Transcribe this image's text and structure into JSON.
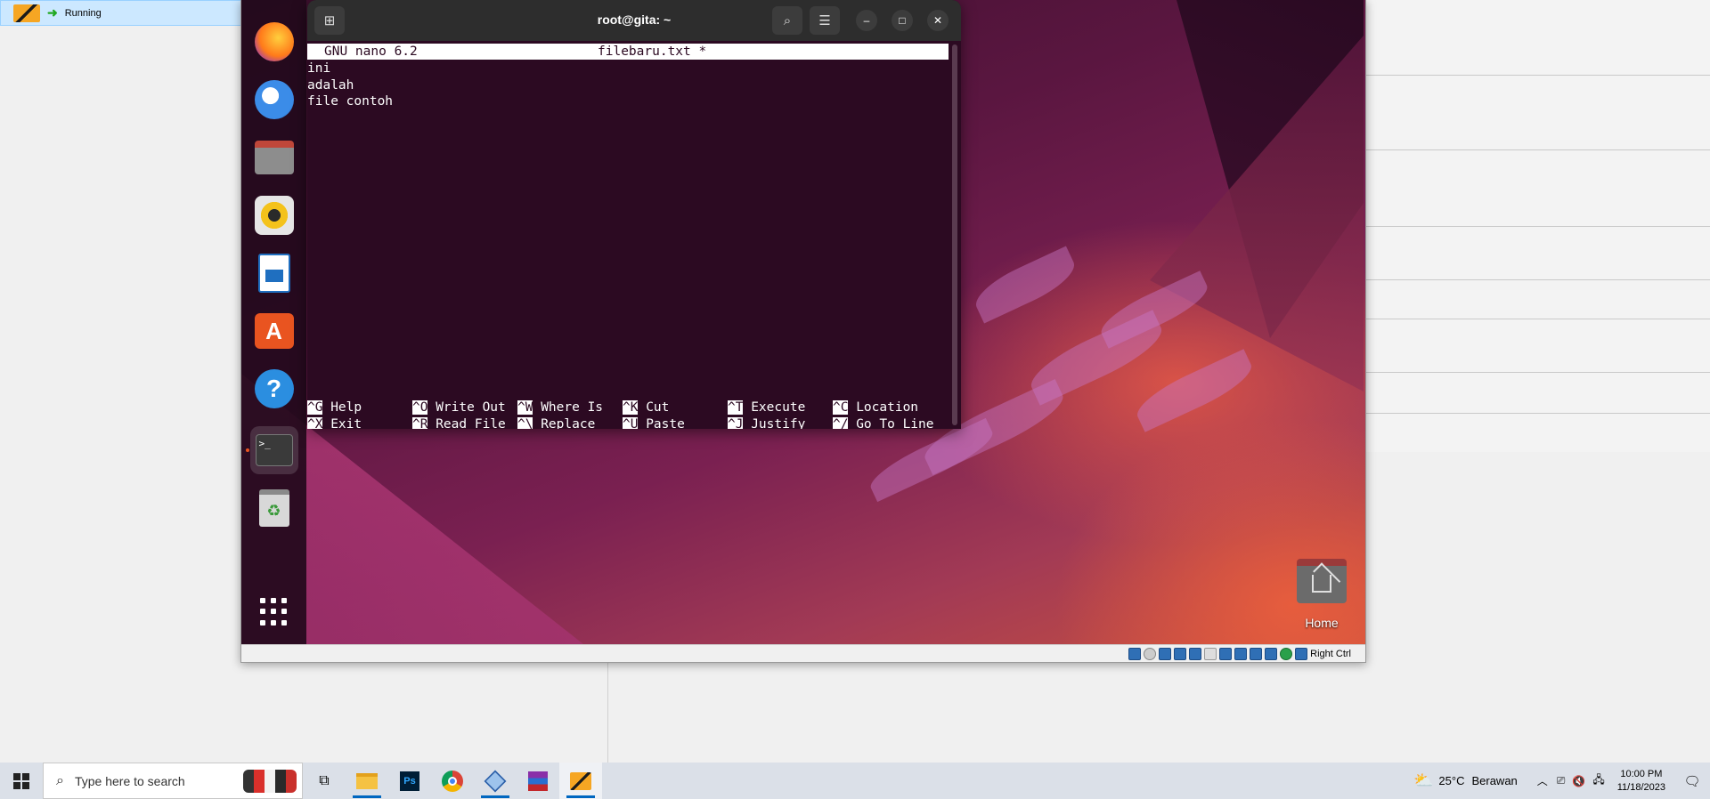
{
  "host": {
    "vm_status": "Running"
  },
  "terminal": {
    "title": "root@gita: ~",
    "nano_version": "GNU nano 6.2",
    "filename": "filebaru.txt *",
    "lines": [
      "ini",
      "adalah",
      "file contoh"
    ],
    "shortcuts_row1": [
      {
        "key": "^G",
        "label": "Help"
      },
      {
        "key": "^O",
        "label": "Write Out"
      },
      {
        "key": "^W",
        "label": "Where Is"
      },
      {
        "key": "^K",
        "label": "Cut"
      },
      {
        "key": "^T",
        "label": "Execute"
      },
      {
        "key": "^C",
        "label": "Location"
      }
    ],
    "shortcuts_row2": [
      {
        "key": "^X",
        "label": "Exit"
      },
      {
        "key": "^R",
        "label": "Read File"
      },
      {
        "key": "^\\",
        "label": "Replace"
      },
      {
        "key": "^U",
        "label": "Paste"
      },
      {
        "key": "^J",
        "label": "Justify"
      },
      {
        "key": "^/",
        "label": "Go To Line"
      }
    ]
  },
  "desktop": {
    "home_label": "Home"
  },
  "vm_statusbar": {
    "host_key": "Right Ctrl"
  },
  "taskbar": {
    "search_placeholder": "Type here to search",
    "weather_temp": "25°C",
    "weather_text": "Berawan",
    "time": "10:00 PM",
    "date": "11/18/2023"
  },
  "colors": {
    "ubuntu_orange": "#e95420",
    "terminal_bg": "#2c0a22",
    "taskbar_accent": "#0067c0"
  }
}
